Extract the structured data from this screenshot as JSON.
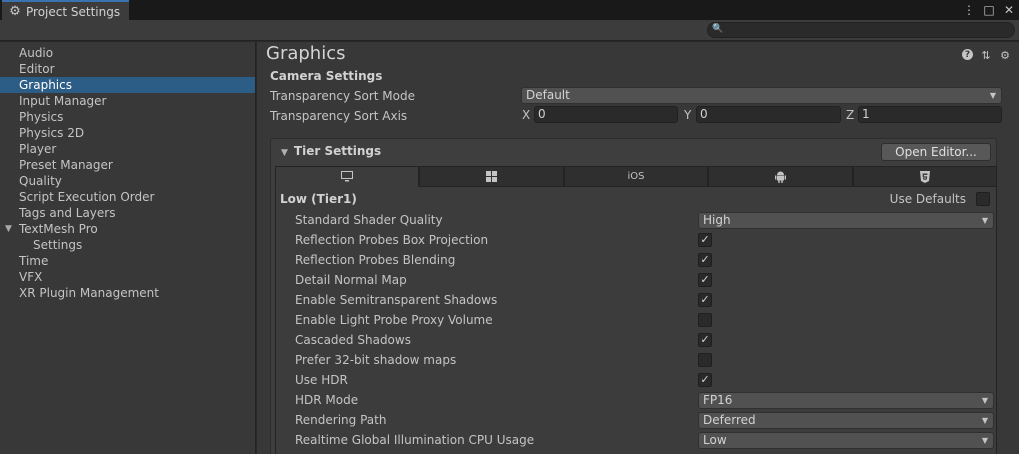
{
  "window": {
    "tab_title": "Project Settings",
    "tab_icon": "gear-icon",
    "controls": [
      "more-options-icon",
      "maximize-icon",
      "close-icon"
    ]
  },
  "search": {
    "placeholder": ""
  },
  "sidebar": {
    "items": [
      {
        "label": "Audio"
      },
      {
        "label": "Editor"
      },
      {
        "label": "Graphics",
        "selected": true
      },
      {
        "label": "Input Manager"
      },
      {
        "label": "Physics"
      },
      {
        "label": "Physics 2D"
      },
      {
        "label": "Player"
      },
      {
        "label": "Preset Manager"
      },
      {
        "label": "Quality"
      },
      {
        "label": "Script Execution Order"
      },
      {
        "label": "Tags and Layers"
      },
      {
        "label": "TextMesh Pro",
        "expanded": true
      },
      {
        "label": "Settings",
        "child": true
      },
      {
        "label": "Time"
      },
      {
        "label": "VFX"
      },
      {
        "label": "XR Plugin Management"
      }
    ]
  },
  "main": {
    "title": "Graphics",
    "camera": {
      "heading": "Camera Settings",
      "sort_mode_label": "Transparency Sort Mode",
      "sort_mode_value": "Default",
      "sort_axis_label": "Transparency Sort Axis",
      "axis": {
        "x_label": "X",
        "x": "0",
        "y_label": "Y",
        "y": "0",
        "z_label": "Z",
        "z": "1"
      }
    },
    "tier": {
      "heading": "Tier Settings",
      "open_editor": "Open Editor...",
      "platforms": [
        {
          "name": "standalone",
          "icon": "monitor-icon",
          "label": ""
        },
        {
          "name": "windows",
          "icon": "windows-icon",
          "label": ""
        },
        {
          "name": "ios",
          "icon": "",
          "label": "iOS"
        },
        {
          "name": "android",
          "icon": "android-icon",
          "label": ""
        },
        {
          "name": "webgl",
          "icon": "html5-icon",
          "label": ""
        }
      ],
      "tier_name": "Low (Tier1)",
      "use_defaults_label": "Use Defaults",
      "use_defaults": false,
      "settings": [
        {
          "label": "Standard Shader Quality",
          "type": "dropdown",
          "value": "High"
        },
        {
          "label": "Reflection Probes Box Projection",
          "type": "checkbox",
          "checked": true
        },
        {
          "label": "Reflection Probes Blending",
          "type": "checkbox",
          "checked": true
        },
        {
          "label": "Detail Normal Map",
          "type": "checkbox",
          "checked": true
        },
        {
          "label": "Enable Semitransparent Shadows",
          "type": "checkbox",
          "checked": true
        },
        {
          "label": "Enable Light Probe Proxy Volume",
          "type": "checkbox",
          "checked": false
        },
        {
          "label": "Cascaded Shadows",
          "type": "checkbox",
          "checked": true
        },
        {
          "label": "Prefer 32-bit shadow maps",
          "type": "checkbox",
          "checked": false
        },
        {
          "label": "Use HDR",
          "type": "checkbox",
          "checked": true
        },
        {
          "label": "HDR Mode",
          "type": "dropdown",
          "value": "FP16"
        },
        {
          "label": "Rendering Path",
          "type": "dropdown",
          "value": "Deferred"
        },
        {
          "label": "Realtime Global Illumination CPU Usage",
          "type": "dropdown",
          "value": "Low"
        }
      ]
    }
  },
  "colors": {
    "selection": "#2c5d87",
    "panel": "#383838",
    "tab_accent": "#3a72b0"
  }
}
